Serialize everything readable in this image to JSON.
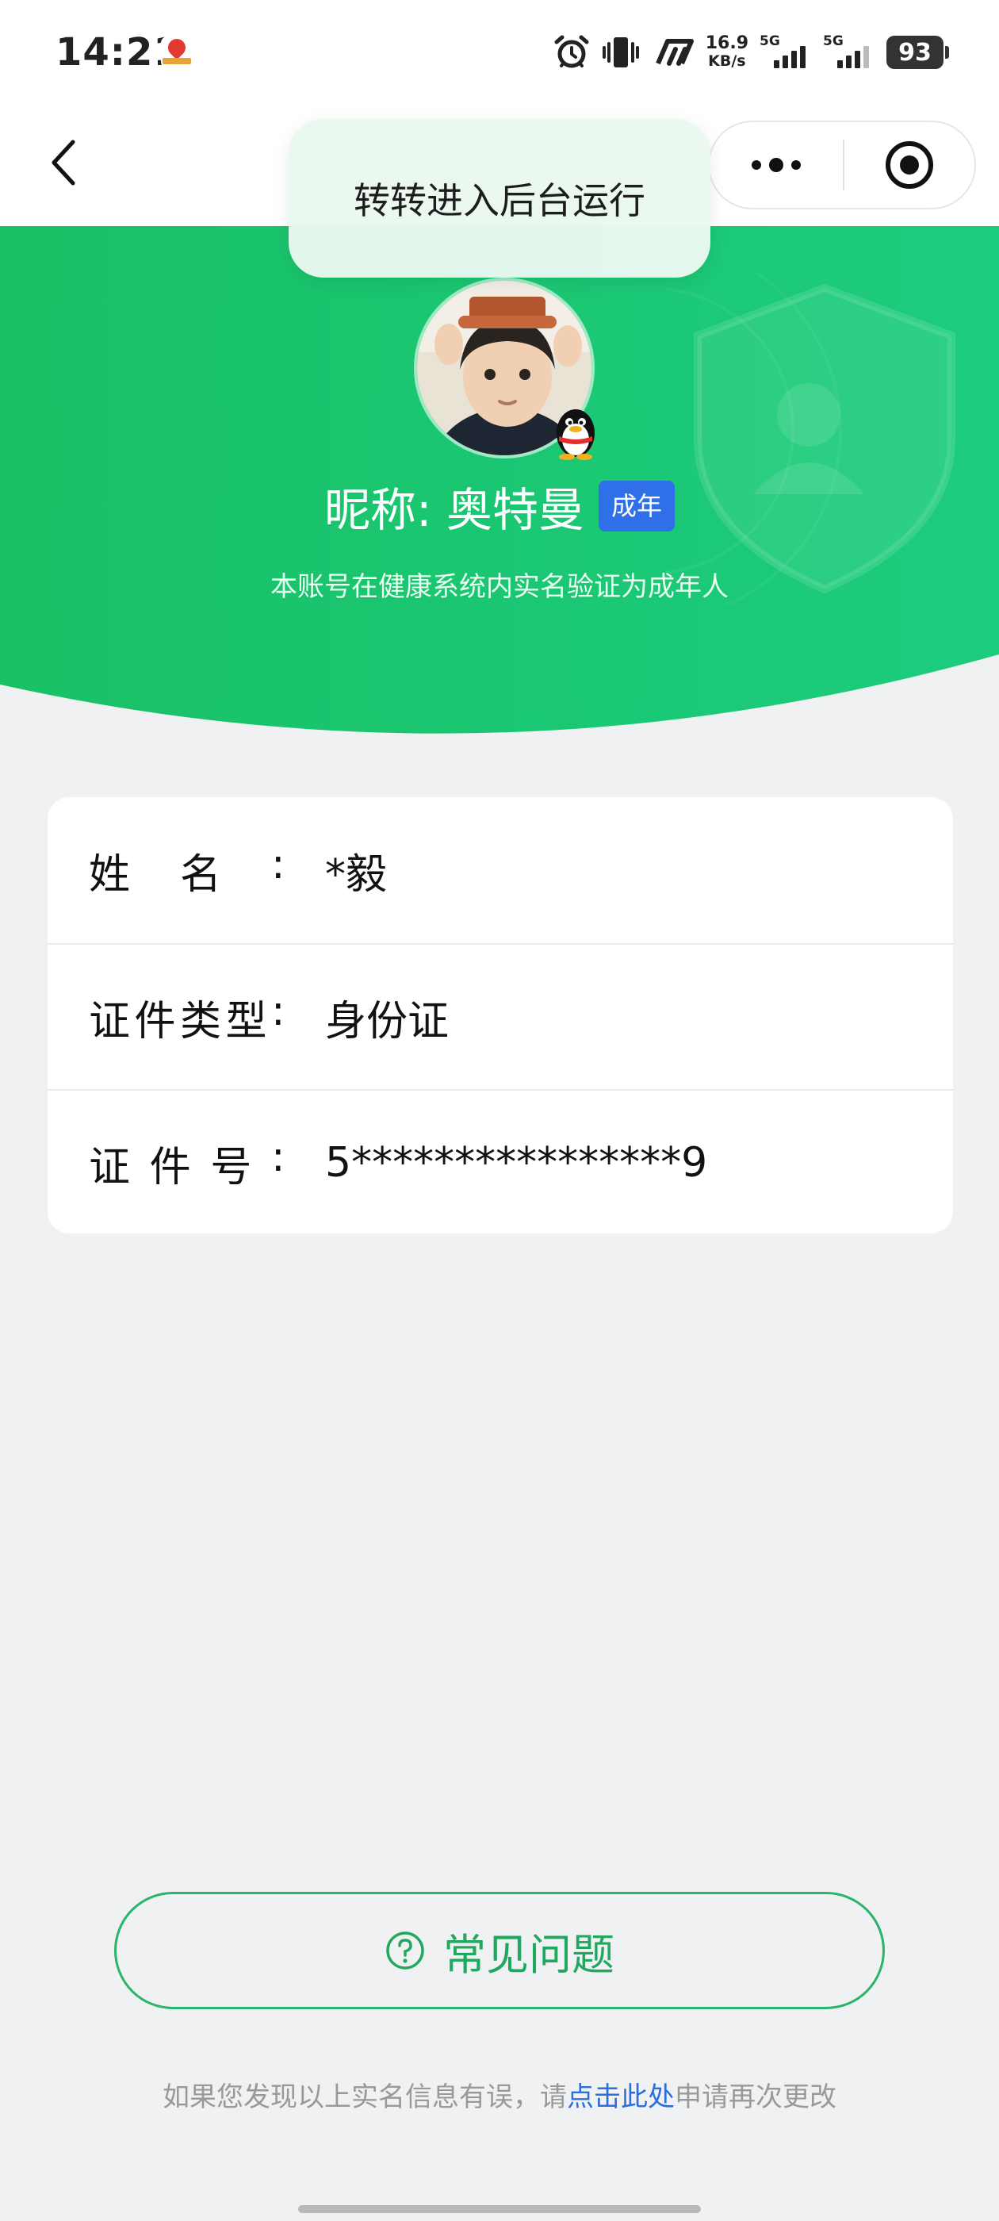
{
  "status_bar": {
    "time": "14:21",
    "net_speed_value": "16.9",
    "net_speed_unit": "KB/s",
    "sim1_label": "5G",
    "sim2_label": "5G",
    "battery_level": "93"
  },
  "toast": {
    "text": "转转进入后台运行"
  },
  "profile": {
    "nickname": "昵称: 奥特曼",
    "age_badge": "成年",
    "verify_note": "本账号在健康系统内实名验证为成年人"
  },
  "info": {
    "rows": [
      {
        "label_chars": [
          "姓",
          "名"
        ],
        "colon": ":",
        "value": "*毅"
      },
      {
        "label_chars": [
          "证",
          "件",
          "类",
          "型"
        ],
        "colon": ":",
        "value": "身份证"
      },
      {
        "label_chars": [
          "证",
          "件",
          "号"
        ],
        "colon": ":",
        "value": "5****************9"
      }
    ]
  },
  "faq": {
    "label": "常见问题"
  },
  "footer": {
    "prefix": "如果您发现以上实名信息有误，请",
    "link": "点击此处",
    "suffix": "申请再次更改"
  },
  "colors": {
    "header_green": "#1fc16e",
    "accent_green": "#21a85f",
    "badge_blue": "#2f6fe8",
    "link_blue": "#2b6fdf"
  }
}
